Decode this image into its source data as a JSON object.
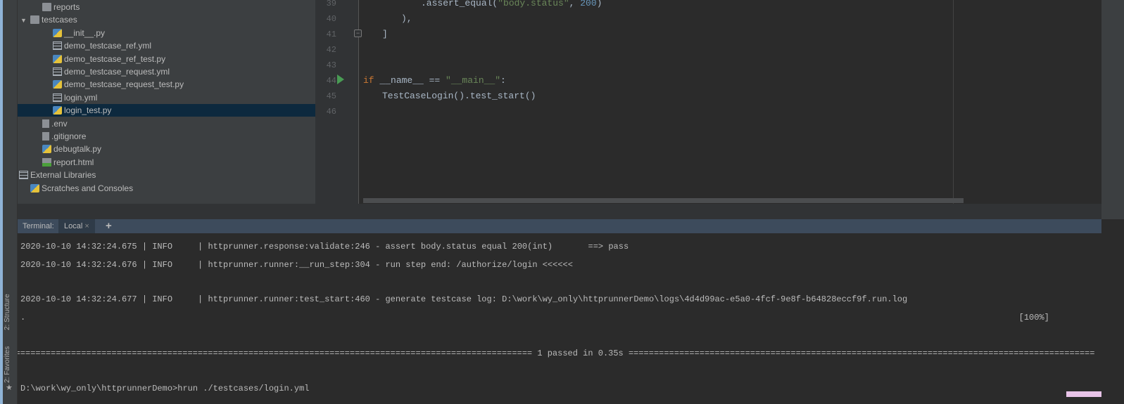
{
  "sidebar_tools": {
    "structure": "2: Structure",
    "favorites": "2: Favorites"
  },
  "tree": [
    {
      "label": "reports",
      "icon": "folder-icon"
    },
    {
      "label": "testcases",
      "icon": "folder-icon",
      "expanded": true
    },
    {
      "label": "__init__.py",
      "icon": "python-file-icon"
    },
    {
      "label": "demo_testcase_ref.yml",
      "icon": "yaml-file-icon"
    },
    {
      "label": "demo_testcase_ref_test.py",
      "icon": "python-file-icon"
    },
    {
      "label": "demo_testcase_request.yml",
      "icon": "yaml-file-icon"
    },
    {
      "label": "demo_testcase_request_test.py",
      "icon": "python-file-icon"
    },
    {
      "label": "login.yml",
      "icon": "yaml-file-icon"
    },
    {
      "label": "login_test.py",
      "icon": "python-file-icon",
      "selected": true
    },
    {
      "label": ".env",
      "icon": "text-file-icon"
    },
    {
      "label": ".gitignore",
      "icon": "text-file-icon"
    },
    {
      "label": "debugtalk.py",
      "icon": "python-file-icon"
    },
    {
      "label": "report.html",
      "icon": "html-file-icon"
    },
    {
      "label": "External Libraries",
      "icon": "library-icon"
    },
    {
      "label": "Scratches and Consoles",
      "icon": "scratches-icon"
    }
  ],
  "editor": {
    "line_numbers": [
      "39",
      "40",
      "41",
      "42",
      "43",
      "44",
      "45",
      "46"
    ],
    "line39": {
      "a": ".assert_equal(",
      "b": "\"body.status\"",
      "c": ", ",
      "d": "200",
      "e": ")"
    },
    "line40": "),",
    "line41": "]",
    "line44": {
      "kw": "if",
      "mid": " __name__ == ",
      "str": "\"__main__\"",
      "end": ":"
    },
    "line45": "TestCaseLogin().test_start()"
  },
  "terminal": {
    "label": "Terminal:",
    "tab": "Local",
    "close": "×",
    "add": "+",
    "lines": [
      "2020-10-10 14:32:24.675 | INFO     | httprunner.response:validate:246 - assert body.status equal 200(int)       ==> pass",
      "2020-10-10 14:32:24.676 | INFO     | httprunner.runner:__run_step:304 - run step end: /authorize/login <<<<<<",
      "2020-10-10 14:32:24.677 | INFO     | httprunner.runner:test_start:460 - generate testcase log: D:\\work\\wy_only\\httprunnerDemo\\logs\\4d4d99ac-e5a0-4fcf-9e8f-b64828eccf9f.run.log",
      ".                                                                                                                                                                                                    [100%]",
      "========================================================================================================= 1 passed in 0.35s ============================================================================================",
      "D:\\work\\wy_only\\httprunnerDemo>hrun ./testcases/login.yml"
    ]
  },
  "colors": {
    "background": "#2b2b2b",
    "panel": "#3c3f41",
    "selection": "#0d293e",
    "keyword": "#cc7832",
    "string": "#6a8759",
    "number": "#6897bb"
  }
}
